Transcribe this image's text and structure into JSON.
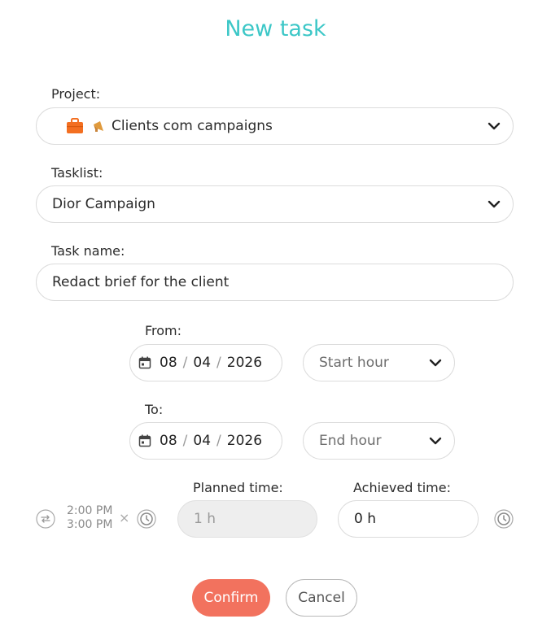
{
  "title": "New task",
  "project": {
    "label": "Project:",
    "value": "Clients com campaigns",
    "icons": [
      "briefcase-icon",
      "megaphone-icon"
    ]
  },
  "tasklist": {
    "label": "Tasklist:",
    "value": "Dior Campaign"
  },
  "task_name": {
    "label": "Task name:",
    "value": "Redact brief for the client"
  },
  "from": {
    "label": "From:",
    "day": "08",
    "month": "04",
    "year": "2026",
    "hour_placeholder": "Start hour"
  },
  "to": {
    "label": "To:",
    "day": "08",
    "month": "04",
    "year": "2026",
    "hour_placeholder": "End hour"
  },
  "schedule": {
    "start_time": "2:00 PM",
    "end_time": "3:00 PM",
    "clear_symbol": "×"
  },
  "planned": {
    "label": "Planned time:",
    "value": "1 h"
  },
  "achieved": {
    "label": "Achieved time:",
    "value": "0 h"
  },
  "buttons": {
    "confirm": "Confirm",
    "cancel": "Cancel"
  },
  "colors": {
    "title": "#3cc7c7",
    "confirm": "#f2725e",
    "briefcase": "#f36f21"
  }
}
